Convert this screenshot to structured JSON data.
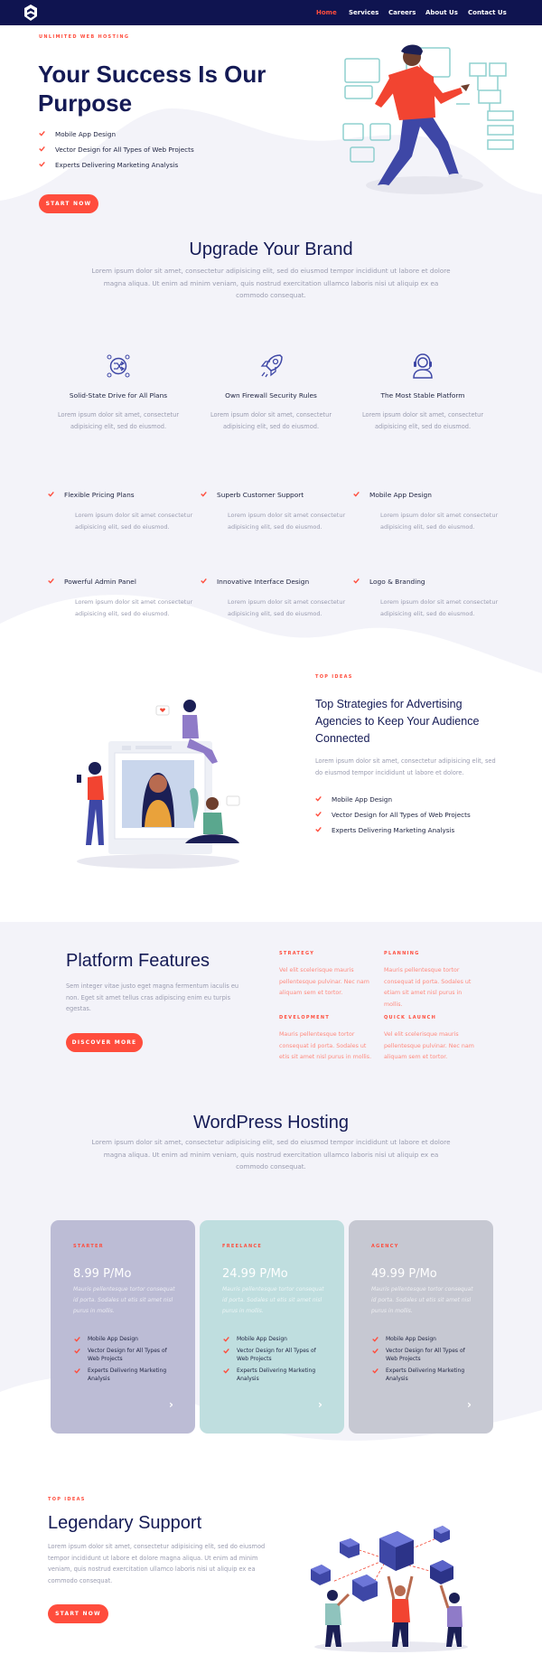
{
  "nav": {
    "items": [
      {
        "label": "Home",
        "active": true
      },
      {
        "label": "Services",
        "active": false
      },
      {
        "label": "Careers",
        "active": false
      },
      {
        "label": "About Us",
        "active": false
      },
      {
        "label": "Contact Us",
        "active": false
      }
    ]
  },
  "hero": {
    "eyebrow": "UNLIMITED WEB HOSTING",
    "title_line1": "Your Success Is Our",
    "title_line2": "Purpose",
    "list": [
      "Mobile App Design",
      "Vector Design for All Types of Web Projects",
      "Experts Delivering Marketing Analysis"
    ],
    "cta": "START NOW"
  },
  "brand": {
    "title": "Upgrade Your Brand",
    "text": "Lorem ipsum dolor sit amet, consectetur adipisicing elit, sed do eiusmod tempor incididunt ut labore et dolore magna aliqua. Ut enim ad minim veniam, quis nostrud exercitation ullamco laboris nisi ut aliquip ex ea commodo consequat.",
    "features": [
      {
        "icon": "shuffle-icon",
        "title": "Solid-State Drive for All Plans",
        "text": "Lorem ipsum dolor sit amet, consectetur adipisicing elit, sed do eiusmod."
      },
      {
        "icon": "rocket-icon",
        "title": "Own Firewall Security Rules",
        "text": "Lorem ipsum dolor sit amet, consectetur adipisicing elit, sed do eiusmod."
      },
      {
        "icon": "headset-icon",
        "title": "The Most Stable Platform",
        "text": "Lorem ipsum dolor sit amet, consectetur adipisicing elit, sed do eiusmod."
      }
    ]
  },
  "grid": {
    "items": [
      {
        "title": "Flexible Pricing Plans",
        "text": "Lorem ipsum dolor sit amet consectetur adipisicing elit, sed do eiusmod."
      },
      {
        "title": "Superb Customer Support",
        "text": "Lorem ipsum dolor sit amet consectetur adipisicing elit, sed do eiusmod."
      },
      {
        "title": "Mobile App Design",
        "text": "Lorem ipsum dolor sit amet consectetur adipisicing elit, sed do eiusmod."
      },
      {
        "title": "Powerful Admin Panel",
        "text": "Lorem ipsum dolor sit amet consectetur adipisicing elit, sed do eiusmod."
      },
      {
        "title": "Innovative Interface Design",
        "text": "Lorem ipsum dolor sit amet consectetur adipisicing elit, sed do eiusmod."
      },
      {
        "title": "Logo & Branding",
        "text": "Lorem ipsum dolor sit amet consectetur adipisicing elit, sed do eiusmod."
      }
    ]
  },
  "ideas": {
    "eyebrow": "TOP IDEAS",
    "title_line1": "Top Strategies for Advertising",
    "title_line2": "Agencies to Keep Your Audience",
    "title_line3": "Connected",
    "text": "Lorem ipsum dolor sit amet, consectetur adipisicing elit, sed do eiusmod tempor incididunt ut labore et dolore.",
    "list": [
      "Mobile App Design",
      "Vector Design for All Types of Web Projects",
      "Experts Delivering Marketing Analysis"
    ]
  },
  "platform": {
    "title": "Platform Features",
    "text": "Sem integer vitae justo eget magna fermentum iaculis eu non. Eget sit amet tellus cras adipiscing enim eu turpis egestas.",
    "cta": "DISCOVER MORE",
    "items": [
      {
        "head": "STRATEGY",
        "text": "Vel elit scelerisque mauris pellentesque pulvinar. Nec nam aliquam sem et tortor."
      },
      {
        "head": "PLANNING",
        "text": "Mauris pellentesque tortor consequat id porta. Sodales ut etiam sit amet nisl purus in mollis."
      },
      {
        "head": "DEVELOPMENT",
        "text": "Mauris pellentesque tortor consequat id porta. Sodales ut etis sit amet nisl purus in mollis."
      },
      {
        "head": "QUICK LAUNCH",
        "text": "Vel elit scelerisque mauris pellentesque pulvinar. Nec nam aliquam sem et tortor."
      }
    ]
  },
  "hosting": {
    "title": "WordPress Hosting",
    "text": "Lorem ipsum dolor sit amet, consectetur adipisicing elit, sed do eiusmod tempor incididunt ut labore et dolore magna aliqua. Ut enim ad minim veniam, quis nostrud exercitation ullamco laboris nisi ut aliquip ex ea commodo consequat.",
    "plans": [
      {
        "name": "STARTER",
        "price": "8.99 P/Mo",
        "desc": "Mauris pellentesque tortor consequat id porta. Sodales ut etis sit amet nisl purus in mollis.",
        "color": "#bcbcd5",
        "features": [
          "Mobile App Design",
          "Vector Design for All Types of Web Projects",
          "Experts Delivering Marketing Analysis"
        ]
      },
      {
        "name": "FREELANCE",
        "price": "24.99 P/Mo",
        "desc": "Mauris pellentesque tortor consequat id porta. Sodales ut etis sit amet nisl purus in mollis.",
        "color": "#bfdedf",
        "features": [
          "Mobile App Design",
          "Vector Design for All Types of Web Projects",
          "Experts Delivering Marketing Analysis"
        ]
      },
      {
        "name": "AGENCY",
        "price": "49.99 P/Mo",
        "desc": "Mauris pellentesque tortor consequat id porta. Sodales ut etis sit amet nisl purus in mollis.",
        "color": "#c6c8d2",
        "features": [
          "Mobile App Design",
          "Vector Design for All Types of Web Projects",
          "Experts Delivering Marketing Analysis"
        ]
      }
    ]
  },
  "support": {
    "eyebrow": "TOP IDEAS",
    "title": "Legendary Support",
    "text": "Lorem ipsum dolor sit amet, consectetur adipisicing elit, sed do eiusmod tempor incididunt ut labore et dolore magna aliqua. Ut enim ad minim veniam, quis nostrud exercitation ullamco laboris nisi ut aliquip ex ea commodo consequat.",
    "cta": "START NOW"
  },
  "colors": {
    "navy": "#0f1450",
    "accent": "#ff4d3d",
    "bg": "#f3f3f9"
  }
}
